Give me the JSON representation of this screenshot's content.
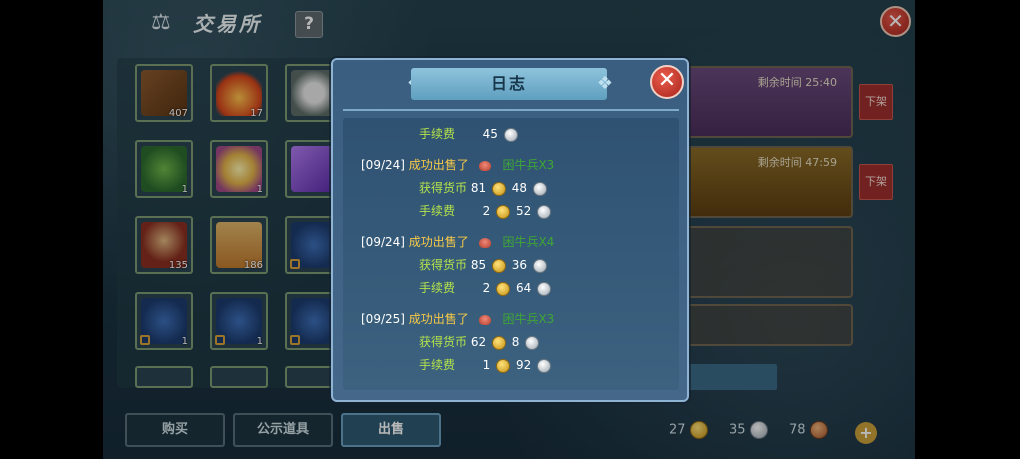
{
  "header": {
    "title": "交易所",
    "help_label": "?"
  },
  "left_slots": [
    {
      "count": "407"
    },
    {
      "count": "17"
    },
    {
      "count": ""
    },
    {
      "count": "1"
    },
    {
      "count": "1"
    },
    {
      "count": ""
    },
    {
      "count": "135"
    },
    {
      "count": "186"
    },
    {
      "count": ""
    },
    {
      "count": "1"
    },
    {
      "count": "1"
    },
    {
      "count": ""
    }
  ],
  "listings": [
    {
      "timer": "剩余时间 25:40",
      "color": "#5b3f6a"
    },
    {
      "timer": "剩余时间 47:59",
      "color": "#7a5419"
    }
  ],
  "offshelf_label": "下架",
  "bottom": {
    "tabs": [
      "购买",
      "公示道具",
      "出售"
    ],
    "currency": {
      "gold": "27",
      "silver": "35",
      "copper": "78"
    }
  },
  "modal": {
    "title": "日志",
    "entries_top": {
      "fee_label": "手续费",
      "fee_silver": "45"
    },
    "entries": [
      {
        "date": "[09/24]",
        "status": "成功出售了",
        "item": "困牛兵X3",
        "gain_label": "获得货币",
        "gain_gold": "81",
        "gain_silver": "48",
        "fee_label": "手续费",
        "fee_gold": "2",
        "fee_silver": "52"
      },
      {
        "date": "[09/24]",
        "status": "成功出售了",
        "item": "困牛兵X4",
        "gain_label": "获得货币",
        "gain_gold": "85",
        "gain_silver": "36",
        "fee_label": "手续费",
        "fee_gold": "2",
        "fee_silver": "64"
      },
      {
        "date": "[09/25]",
        "status": "成功出售了",
        "item": "困牛兵X3",
        "gain_label": "获得货币",
        "gain_gold": "62",
        "gain_silver": "8",
        "fee_label": "手续费",
        "fee_gold": "1",
        "fee_silver": "92"
      }
    ]
  }
}
